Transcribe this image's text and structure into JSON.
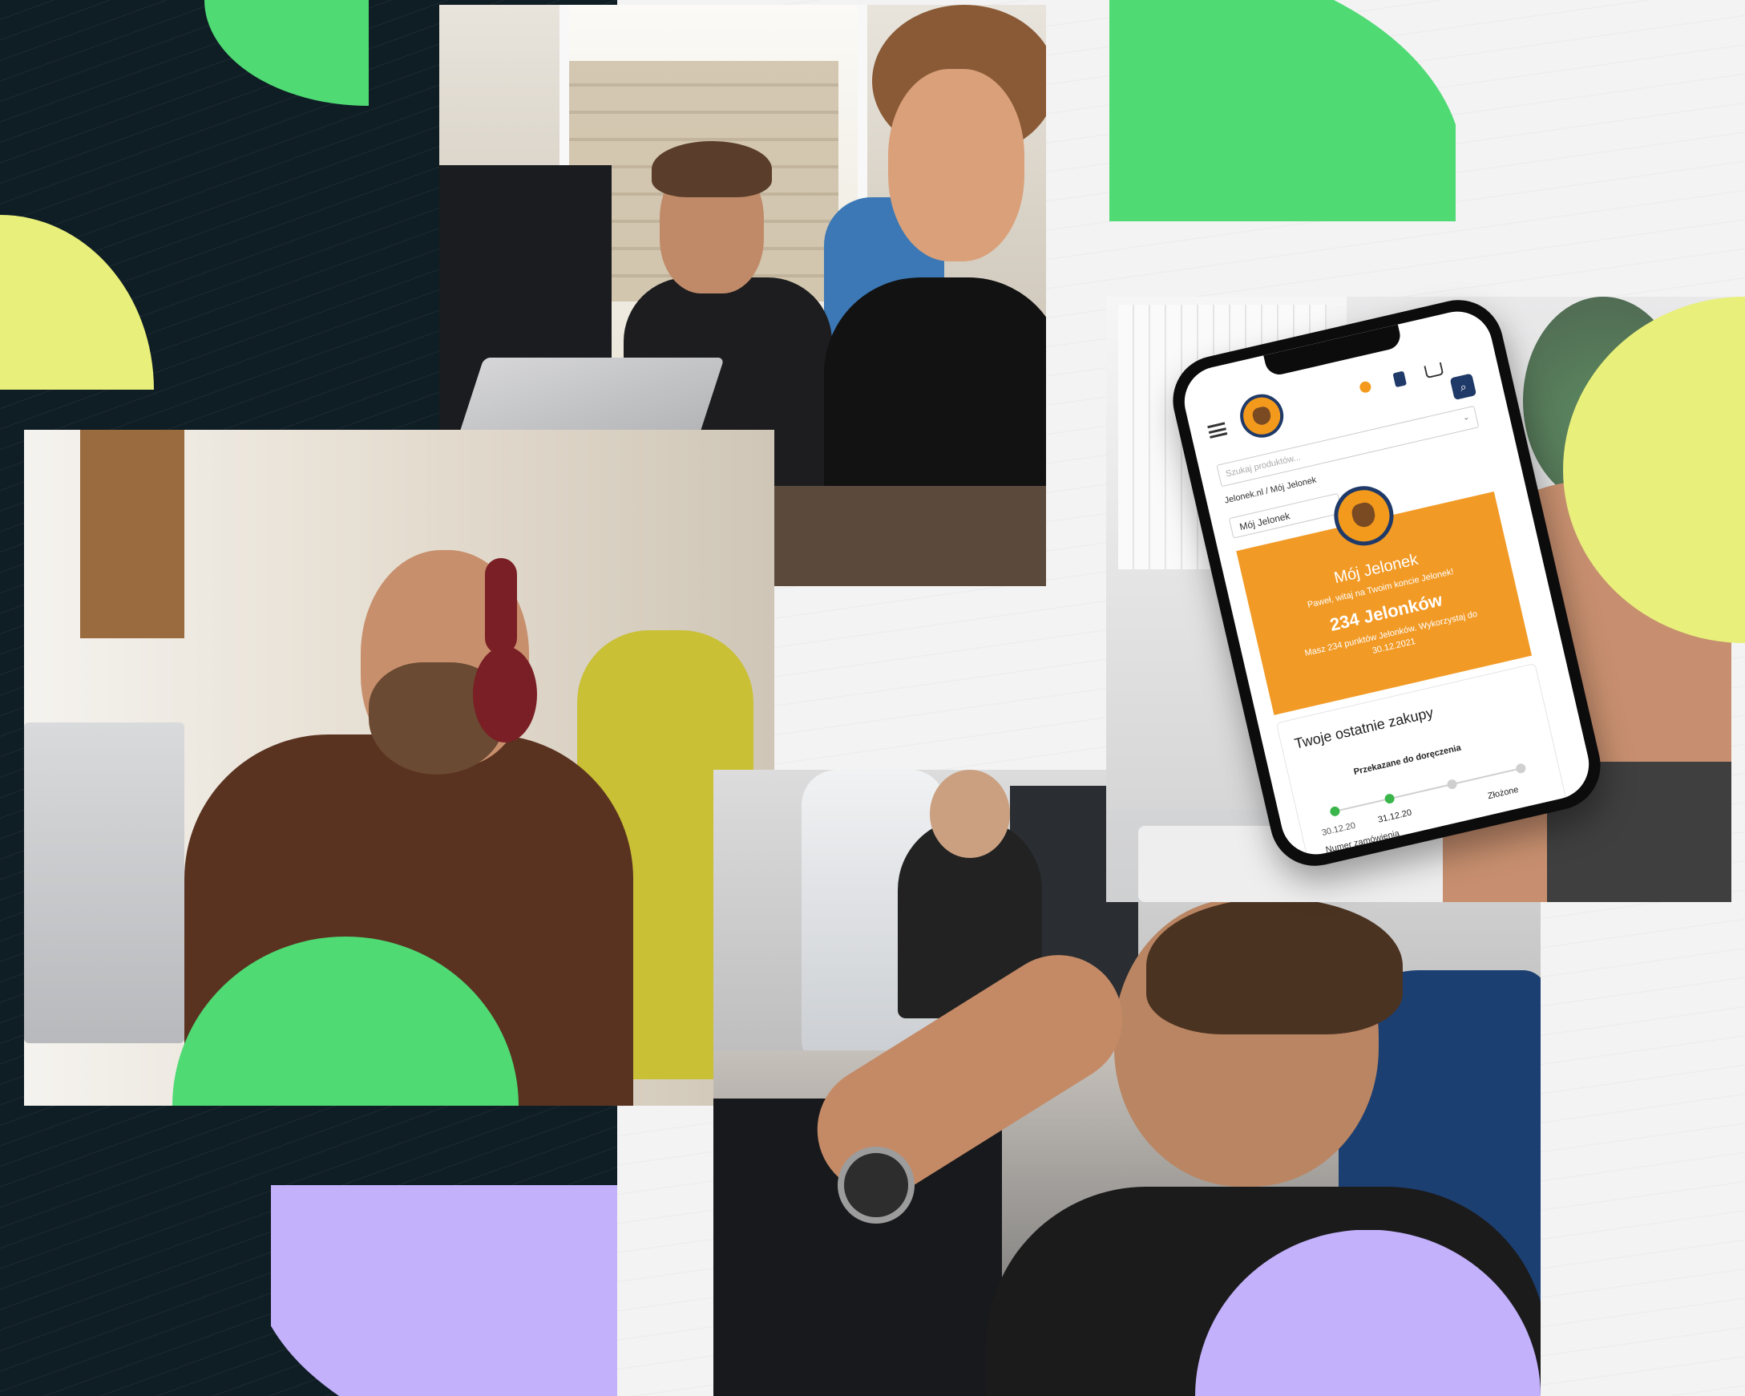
{
  "colors": {
    "dark_background": "#0f1d24",
    "green_shape": "#4fda74",
    "yellow_shape": "#e8ef7b",
    "purple_shape": "#c3b1fc",
    "orange_brand": "#f29a26",
    "navy_brand": "#1f3a68"
  },
  "phone": {
    "icons": [
      "menu-icon",
      "logo",
      "user-icon",
      "grid-icon",
      "cart-icon",
      "search-icon"
    ],
    "search_placeholder": "Szukaj produktów...",
    "breadcrumb": "Jelonek.nl  /  Mój Jelonek",
    "section_select": "Mój Jelonek",
    "card": {
      "title": "Mój Jelonek",
      "welcome": "Paweł, witaj na Twoim koncie Jelonek!",
      "points": "234 Jelonków",
      "subtitle": "Masz 234 punktów Jelonków. Wykorzystaj do 30.12.2021"
    },
    "recent": {
      "title": "Twoje ostatnie zakupy",
      "timeline_label": "Przekazane do doręczenia",
      "date_1": "30.12.20",
      "date_2": "31.12.20",
      "status": "Złożone",
      "order_number_label": "Numer zamówienia"
    }
  }
}
